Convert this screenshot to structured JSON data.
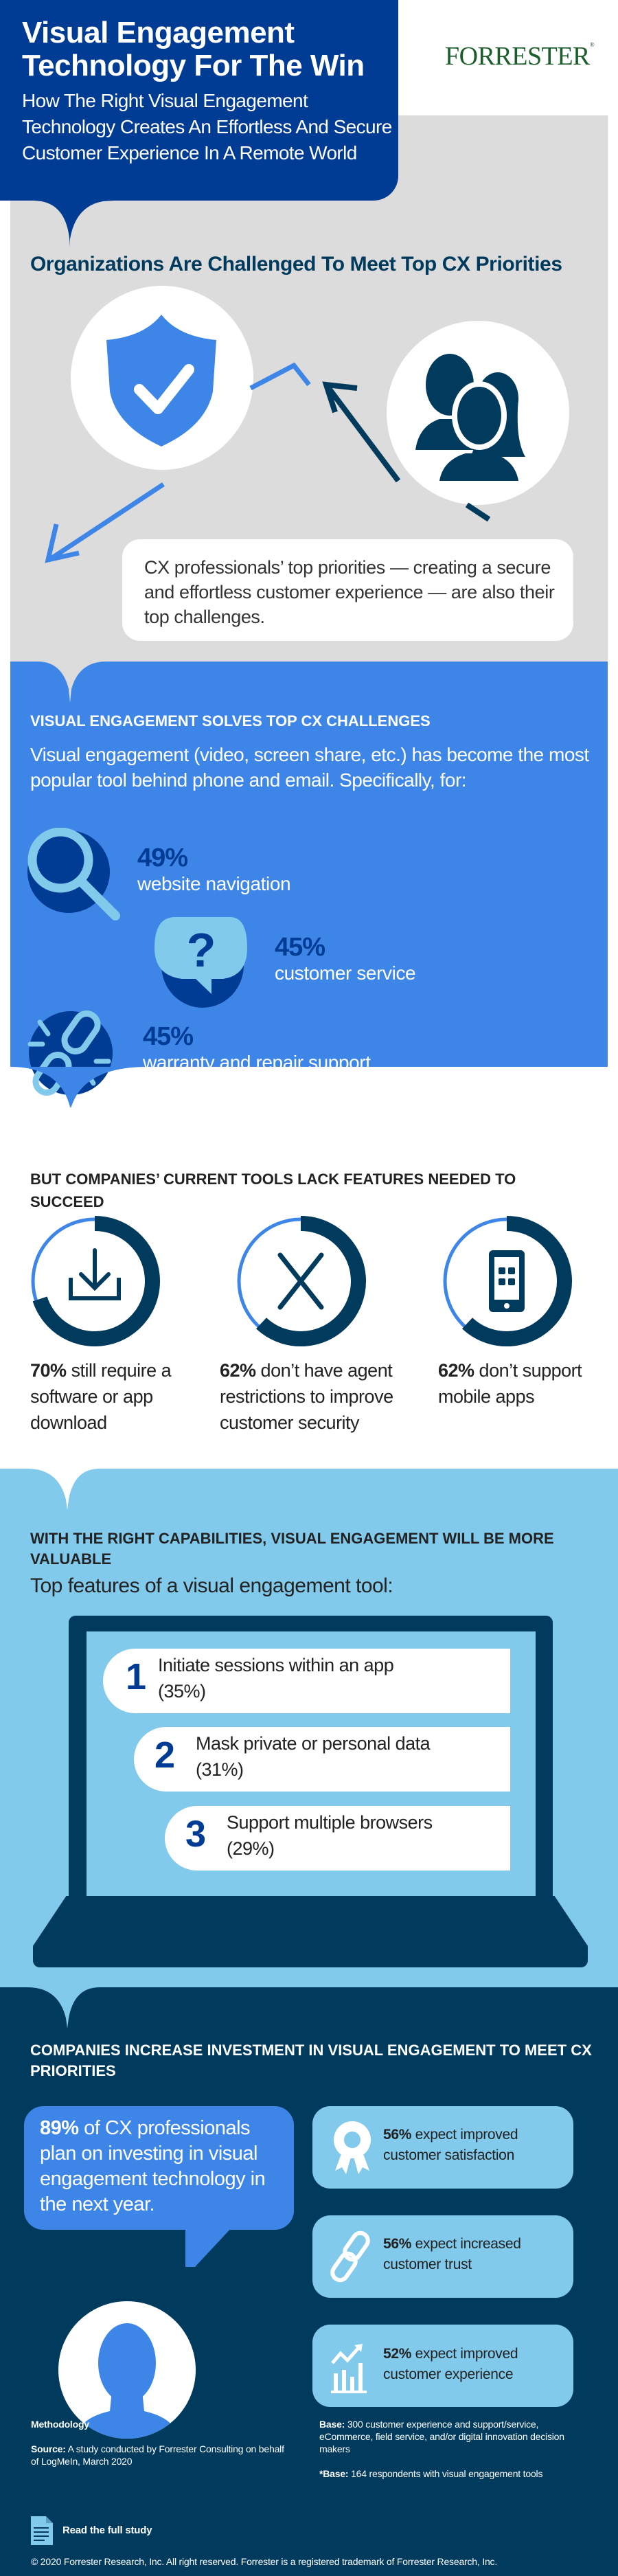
{
  "header": {
    "title": "Visual Engagement Technology For The Win",
    "subtitle": "How The Right Visual Engagement Technology Creates An Effortless And Secure Customer Experience In A Remote World",
    "logo": "FORRESTER",
    "logo_mark": "®"
  },
  "challenges": {
    "title": "Organizations Are Challenged To Meet Top CX Priorities",
    "icons": [
      "shield-check-icon",
      "people-icon"
    ],
    "callout": "CX professionals’ top priorities — creating a secure and effortless customer experience — are also their top challenges."
  },
  "solves": {
    "title": "VISUAL ENGAGEMENT SOLVES TOP CX CHALLENGES",
    "body": "Visual engagement (video, screen share, etc.) has become the most popular tool behind phone and email. Specifically, for:",
    "items": [
      {
        "pct": "49%",
        "label": "website navigation",
        "icon": "magnifier-icon"
      },
      {
        "pct": "45%",
        "label": "customer service",
        "icon": "question-bubble-icon"
      },
      {
        "pct": "45%",
        "label": "warranty and repair support",
        "icon": "broken-link-icon"
      }
    ]
  },
  "lack": {
    "title": "BUT COMPANIES’ CURRENT TOOLS LACK FEATURES NEEDED TO SUCCEED",
    "stats": [
      {
        "pct": "70%",
        "value": 70,
        "text": " still require a software or app download",
        "icon": "download-icon"
      },
      {
        "pct": "62%",
        "value": 62,
        "text": " don’t have agent restrictions to improve customer security",
        "icon": "x-icon"
      },
      {
        "pct": "62%",
        "value": 62,
        "text": " don’t support mobile apps",
        "icon": "mobile-icon"
      }
    ],
    "colors": {
      "filled": "#003a5d",
      "remaining": "#3d86e8"
    }
  },
  "capabilities": {
    "title": "WITH THE RIGHT CAPABILITIES, VISUAL ENGAGEMENT WILL BE MORE VALUABLE",
    "subtitle": "Top features of a visual engagement tool:",
    "features": [
      {
        "rank": "1",
        "text": "Initiate sessions within an app",
        "pct": "(35%)"
      },
      {
        "rank": "2",
        "text": "Mask private or personal data",
        "pct": "(31%)"
      },
      {
        "rank": "3",
        "text": "Support multiple browsers",
        "pct": "(29%)"
      }
    ]
  },
  "investment": {
    "title": "COMPANIES INCREASE INVESTMENT IN VISUAL ENGAGEMENT TO MEET CX PRIORITIES",
    "bubble_pct": "89%",
    "bubble_text": " of CX professionals plan on investing in visual engagement technology in the next year.",
    "expectations": [
      {
        "pct": "56%",
        "text": " expect improved customer satisfaction",
        "icon": "award-ribbon-icon"
      },
      {
        "pct": "56%",
        "text": " expect increased customer trust",
        "icon": "chain-link-icon"
      },
      {
        "pct": "52%",
        "text": " expect improved customer experience",
        "icon": "growth-chart-icon"
      }
    ]
  },
  "footer": {
    "methodology": "Methodology",
    "source_label": "Source:",
    "source_text": " A study conducted by Forrester Consulting on behalf of LogMeIn, March 2020",
    "base_label": "Base:",
    "base_text": " 300 customer experience and support/service, eCommerce, field service, and/or digital innovation decision makers",
    "base2_label": "*Base:",
    "base2_text": " 164 respondents with visual engagement tools",
    "read_study": "Read the full study",
    "copyright": "© 2020 Forrester Research, Inc. All right reserved. Forrester is a registered trademark of Forrester Research, Inc."
  },
  "colors": {
    "royal_blue": "#003b94",
    "bright_blue": "#3d86e8",
    "light_blue": "#82caeb",
    "navy": "#003a5d",
    "gray": "#dcdcdc",
    "forrester_green": "#1b5e2b"
  }
}
